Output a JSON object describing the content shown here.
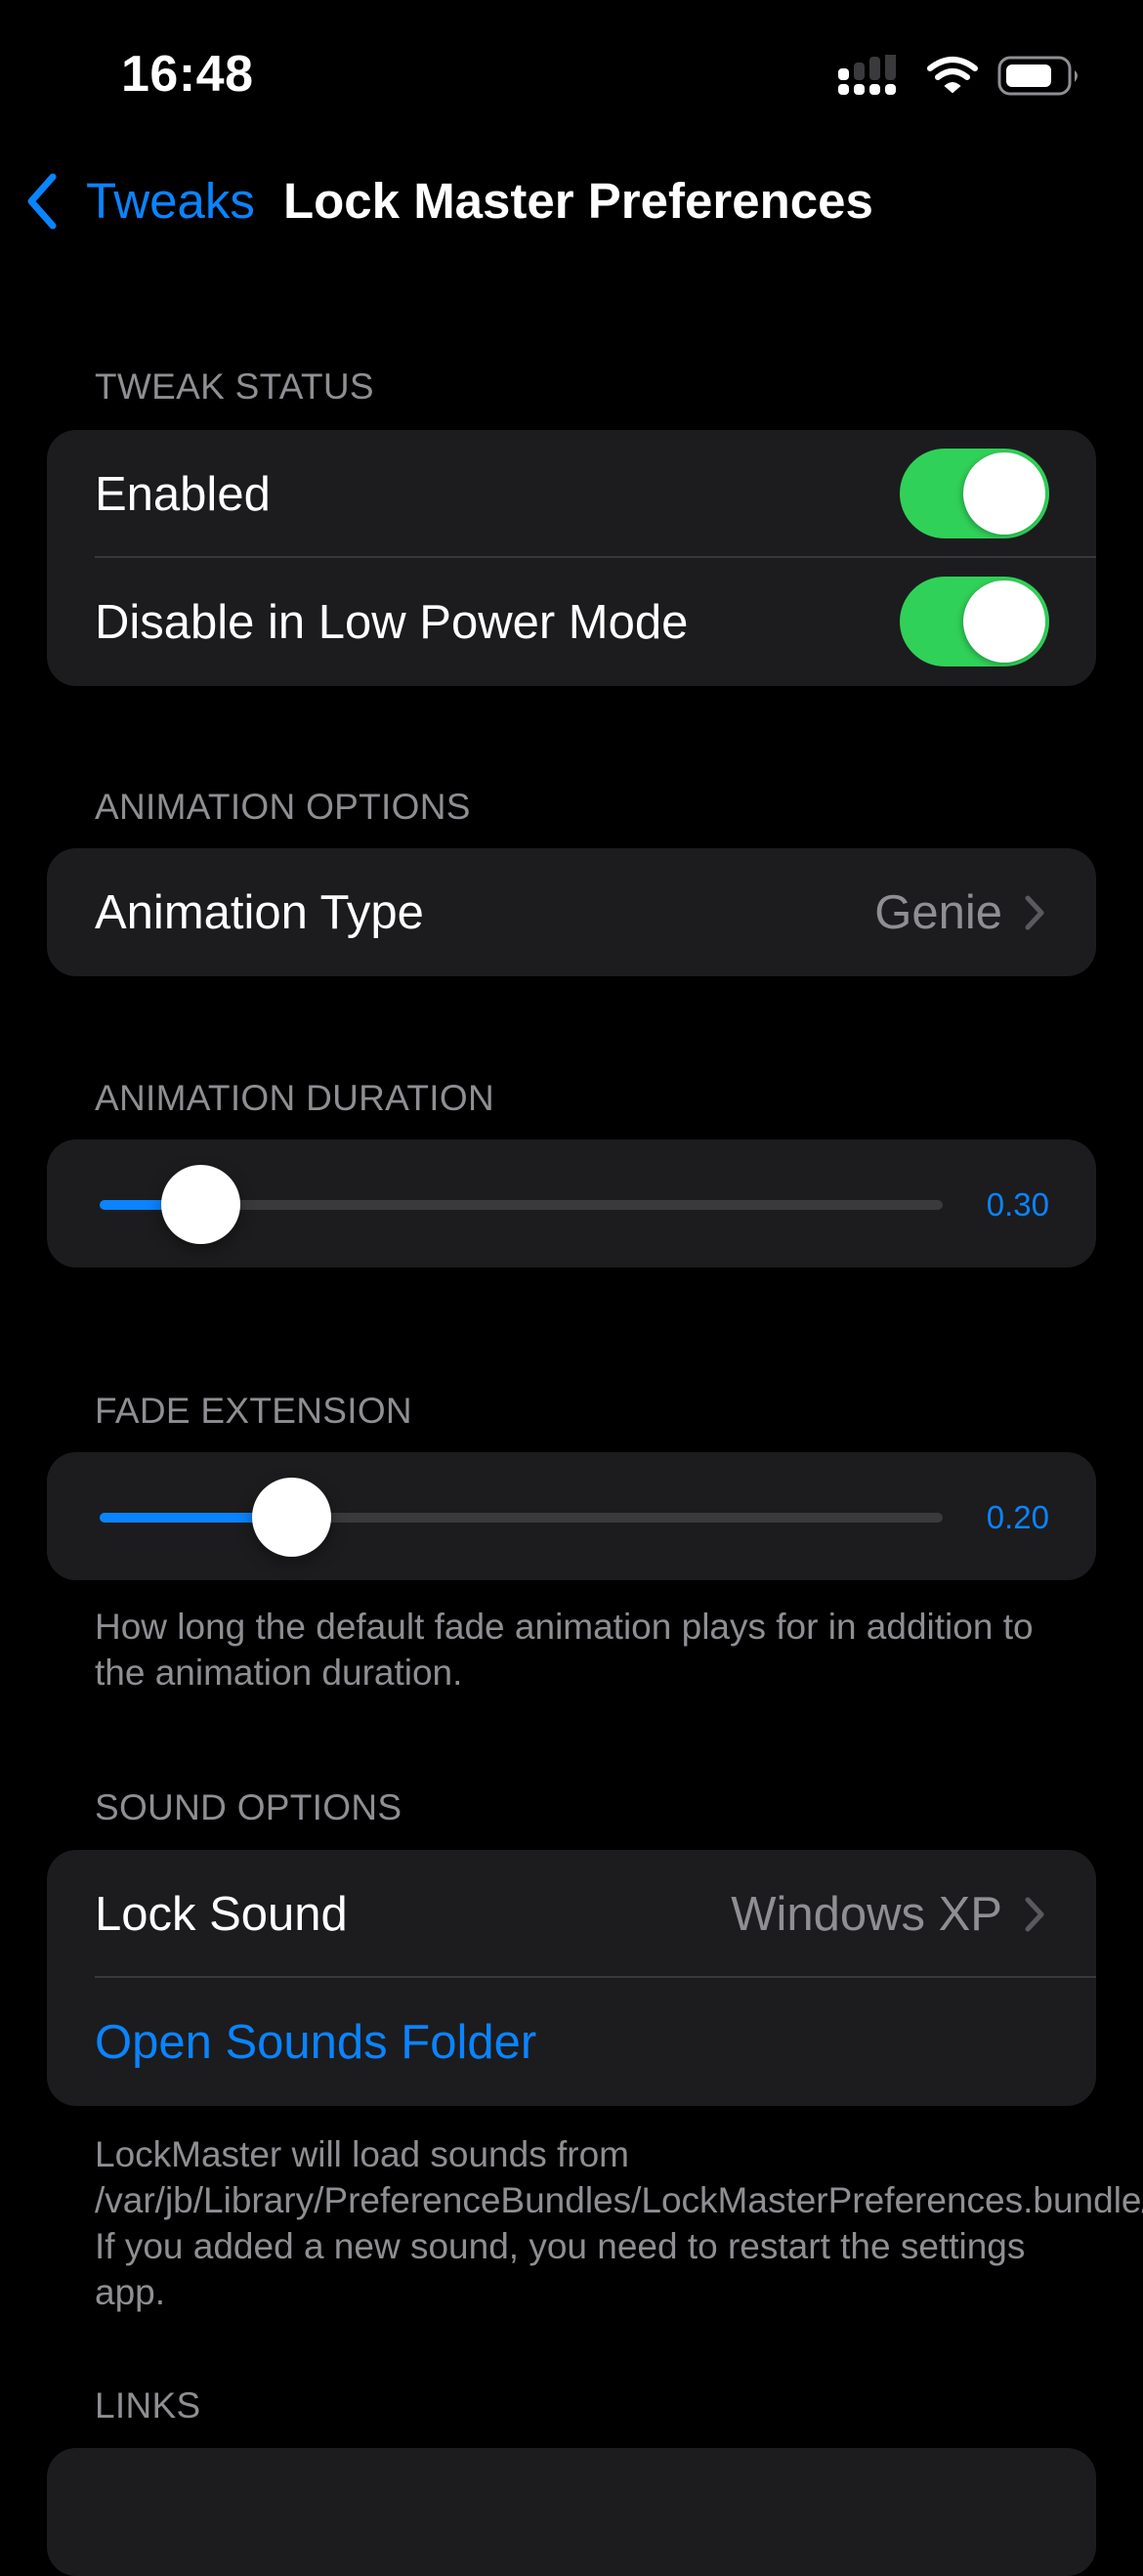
{
  "status_bar": {
    "time": "16:48",
    "signal_icon": "cellular-signal-icon",
    "signal_bars": 1,
    "signal_bars_total": 4,
    "wifi_icon": "wifi-icon",
    "battery_icon": "battery-icon",
    "battery_level": 0.75
  },
  "nav": {
    "back_icon": "chevron-left-icon",
    "back_label": "Tweaks",
    "title": "Lock Master Preferences"
  },
  "colors": {
    "accent": "#0a84ff",
    "toggle_on": "#30d158",
    "background": "#000000",
    "card": "#1c1c1e",
    "secondary_text": "#8e8e93"
  },
  "sections": {
    "tweak_status": {
      "header": "TWEAK STATUS",
      "rows": [
        {
          "label": "Enabled",
          "toggle_on": true
        },
        {
          "label": "Disable in Low Power Mode",
          "toggle_on": true
        }
      ]
    },
    "animation_options": {
      "header": "ANIMATION OPTIONS",
      "rows": [
        {
          "label": "Animation Type",
          "value": "Genie",
          "icon": "chevron-right-icon"
        }
      ]
    },
    "animation_duration": {
      "header": "ANIMATION DURATION",
      "slider": {
        "value_label": "0.30",
        "fraction": 0.08
      }
    },
    "fade_extension": {
      "header": "FADE EXTENSION",
      "slider": {
        "value_label": "0.20",
        "fraction": 0.2
      },
      "footer": "How long the default fade animation plays for in addition to the animation duration."
    },
    "sound_options": {
      "header": "SOUND OPTIONS",
      "rows": [
        {
          "label": "Lock Sound",
          "value": "Windows XP",
          "icon": "chevron-right-icon"
        },
        {
          "label": "Open Sounds Folder"
        }
      ],
      "footer": "LockMaster will load sounds from /var/jb/Library/PreferenceBundles/LockMasterPreferences.bundle/LockSounds/. If you added a new sound, you need to restart the settings app."
    },
    "links": {
      "header": "LINKS"
    }
  }
}
